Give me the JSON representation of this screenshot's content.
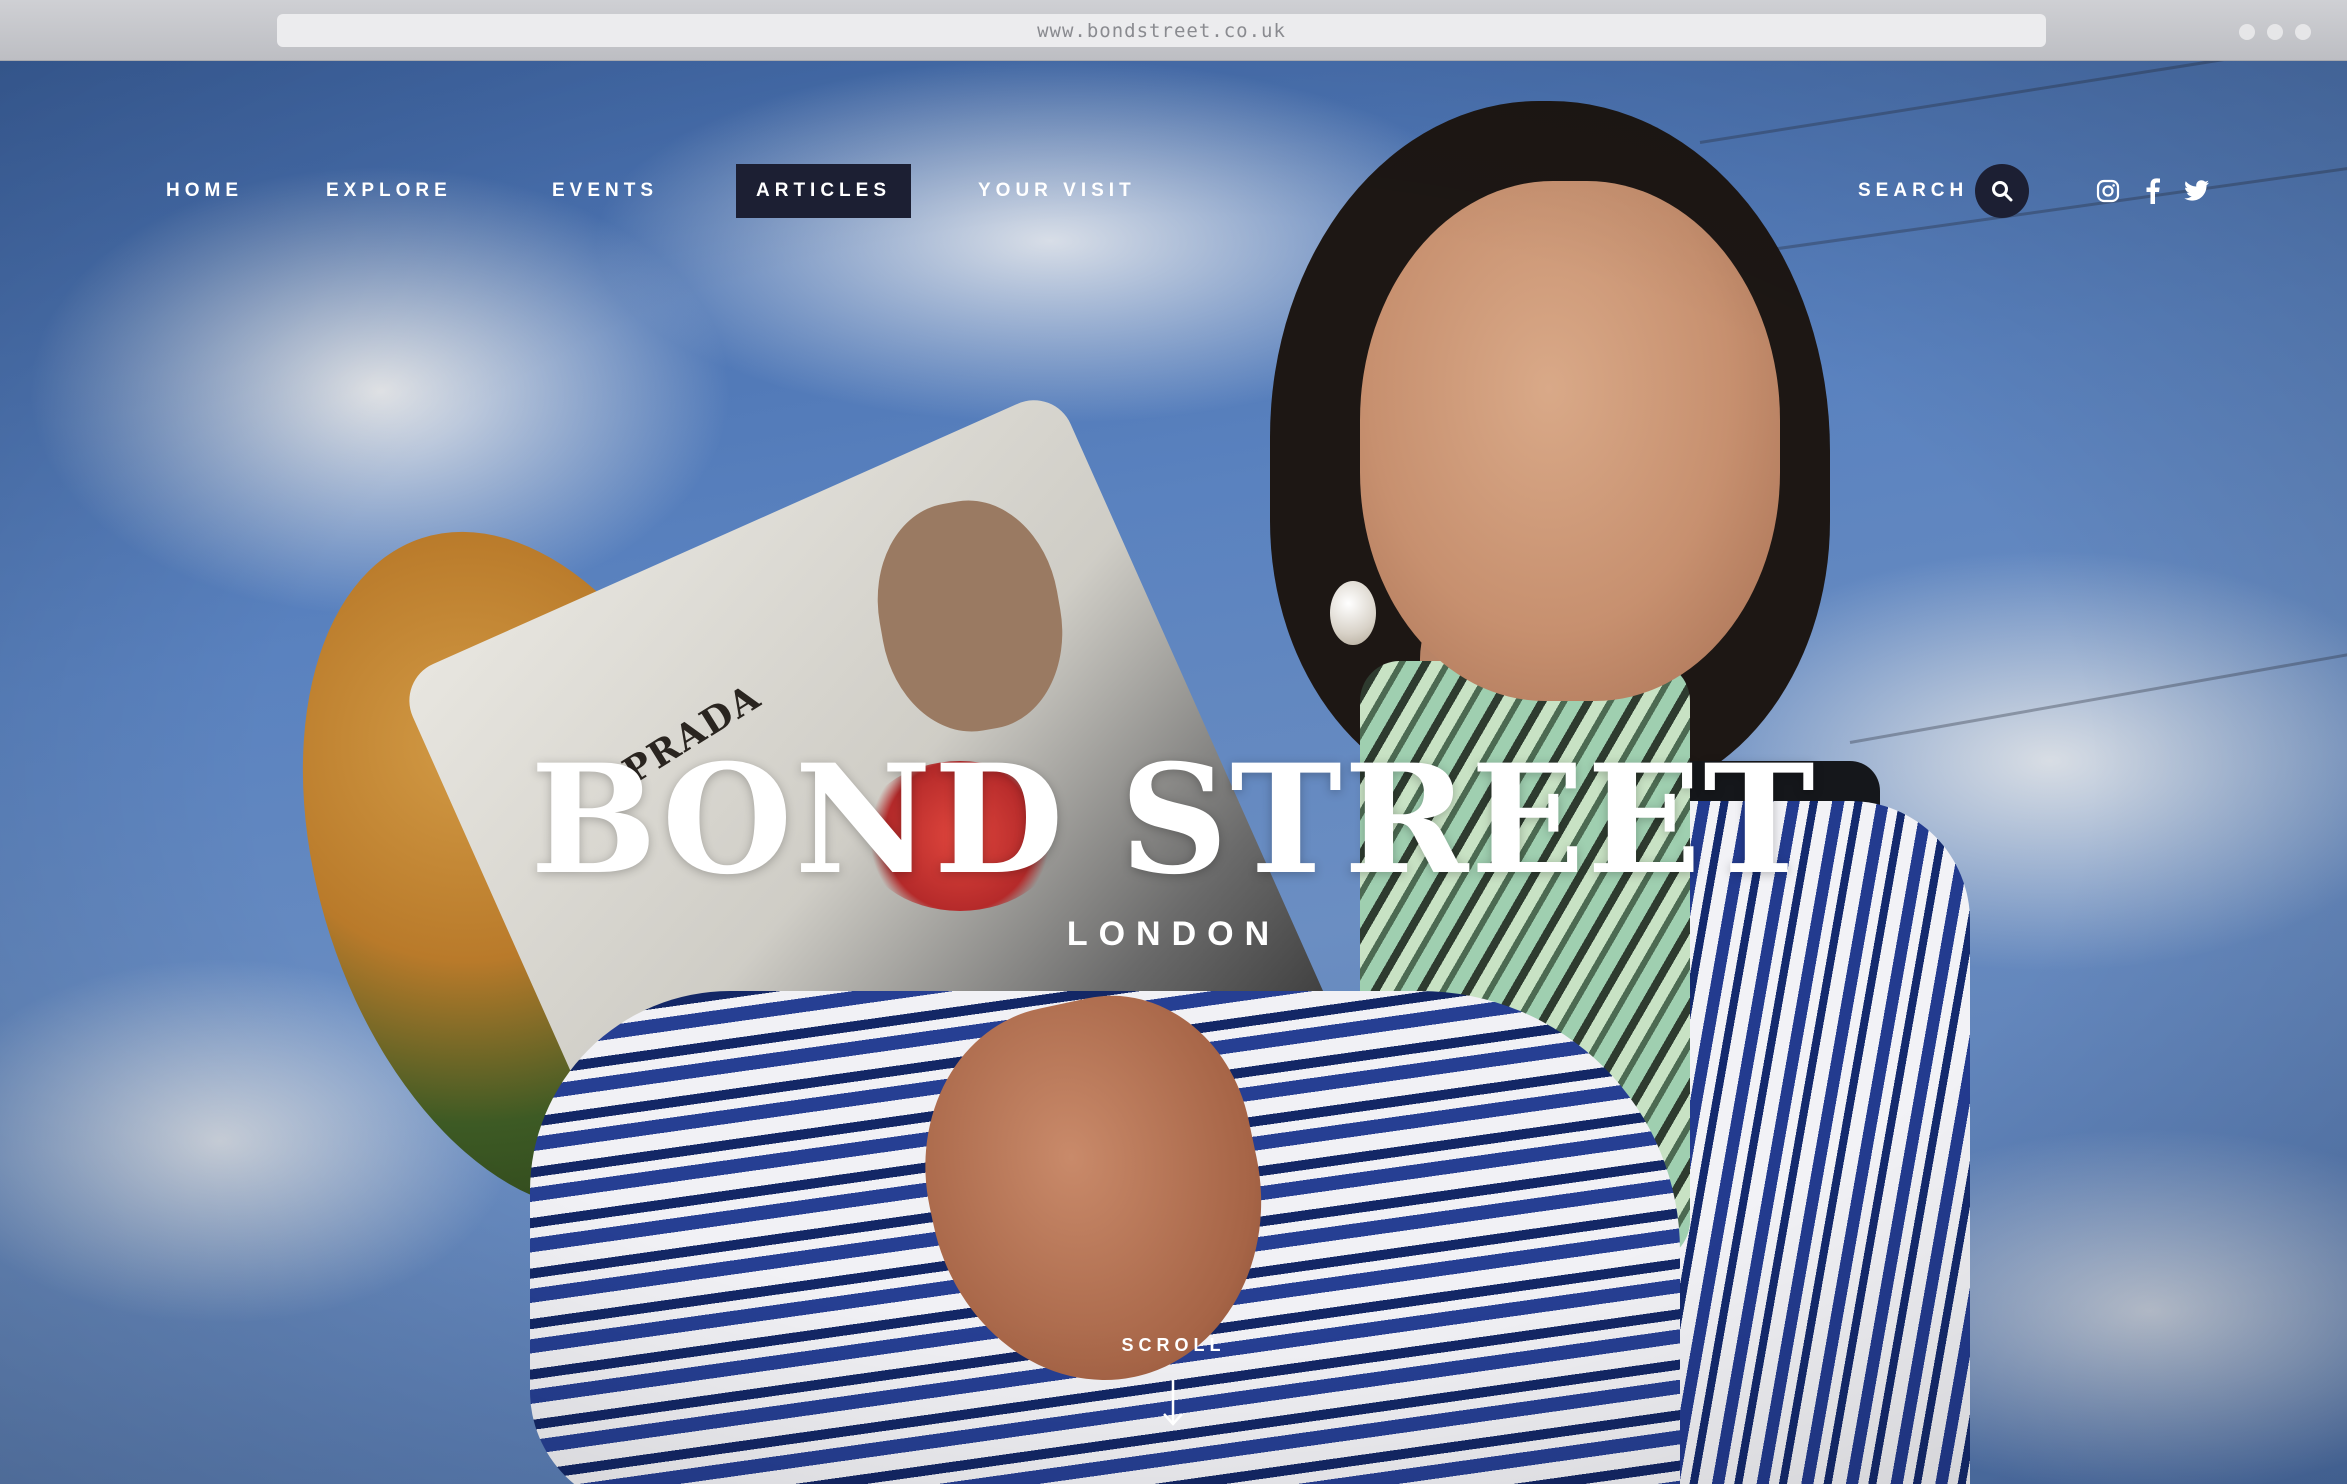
{
  "browser": {
    "url": "www.bondstreet.co.uk"
  },
  "nav": {
    "items": [
      {
        "label": "HOME",
        "active": false
      },
      {
        "label": "EXPLORE",
        "active": false
      },
      {
        "label": "EVENTS",
        "active": false
      },
      {
        "label": "ARTICLES",
        "active": true
      },
      {
        "label": "YOUR VISIT",
        "active": false
      }
    ],
    "search_label": "SEARCH",
    "icons": [
      "search-icon",
      "instagram-icon",
      "facebook-icon",
      "twitter-icon"
    ]
  },
  "hero": {
    "title": "BOND STREET",
    "subtitle": "LONDON",
    "newspaper_text": "PRADA",
    "scroll_label": "SCROLL"
  },
  "colors": {
    "accent": "#1c1f33",
    "text": "#ffffff",
    "sky": "#5a82bf"
  }
}
